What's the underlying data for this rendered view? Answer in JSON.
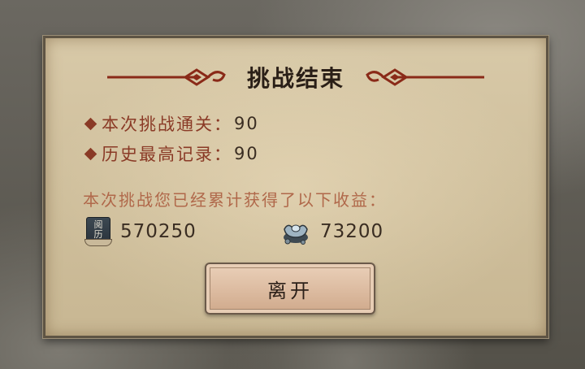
{
  "dialog": {
    "title": "挑战结束",
    "stats": [
      {
        "label": "本次挑战通关：",
        "value": "90"
      },
      {
        "label": "历史最高记录：",
        "value": "90"
      }
    ],
    "gains_label": "本次挑战您已经累计获得了以下收益：",
    "rewards": [
      {
        "icon": "book-icon",
        "icon_text": [
          "阅",
          "历"
        ],
        "value": "570250"
      },
      {
        "icon": "silver-ingot-icon",
        "value": "73200"
      }
    ],
    "leave_button": "离开"
  },
  "colors": {
    "stat_label": "#8a3a26",
    "gains_label": "#b0684a",
    "ornament": "#8a2a18",
    "panel": "#d3c4a2"
  }
}
